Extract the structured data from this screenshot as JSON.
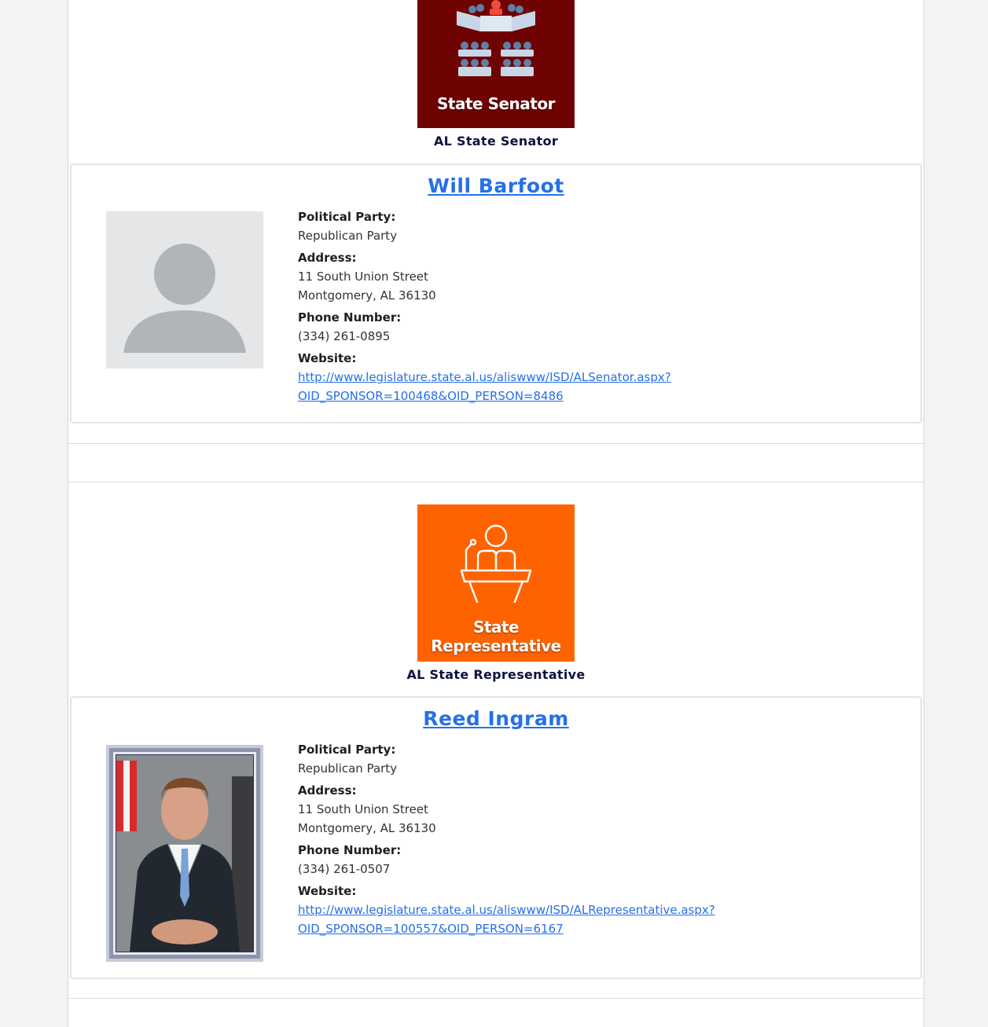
{
  "colors": {
    "senator_badge_bg": "#6e0302",
    "representative_badge_bg": "#ff6300",
    "link": "#2670e8",
    "caption": "#0f1140"
  },
  "offices": [
    {
      "badge_icon": "senate-chamber-icon",
      "badge_text": "State Senator",
      "caption": "AL State Senator",
      "official": {
        "name": "Will Barfoot",
        "photo_icon": "default-avatar-icon",
        "party_label": "Political Party:",
        "party": "Republican Party",
        "address_label": "Address:",
        "address_line1": "11 South Union Street",
        "address_line2": "Montgomery, AL 36130",
        "phone_label": "Phone Number:",
        "phone": "(334) 261-0895",
        "website_label": "Website:",
        "website_line1": "http://www.legislature.state.al.us/aliswww/ISD/ALSenator.aspx?",
        "website_line2": "OID_SPONSOR=100468&OID_PERSON=8486"
      }
    },
    {
      "badge_icon": "podium-speaker-icon",
      "badge_text_line1": "State",
      "badge_text_line2": "Representative",
      "caption": "AL State Representative",
      "official": {
        "name": "Reed Ingram",
        "photo_icon": "official-portrait-photo",
        "party_label": "Political Party:",
        "party": "Republican Party",
        "address_label": "Address:",
        "address_line1": "11 South Union Street",
        "address_line2": "Montgomery, AL 36130",
        "phone_label": "Phone Number:",
        "phone": "(334) 261-0507",
        "website_label": "Website:",
        "website_line1": "http://www.legislature.state.al.us/aliswww/ISD/ALRepresentative.aspx?",
        "website_line2": "OID_SPONSOR=100557&OID_PERSON=6167"
      }
    }
  ]
}
